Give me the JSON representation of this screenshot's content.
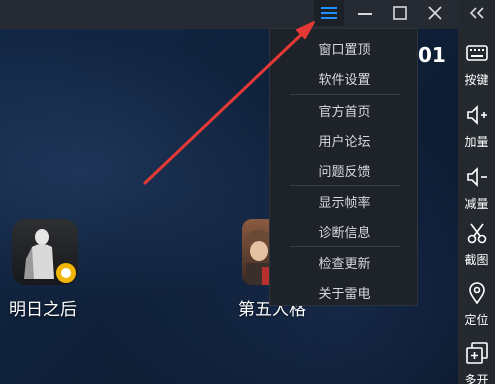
{
  "titlebar": {
    "icons": {
      "menu": "hamburger-menu-icon",
      "minimize": "minimize-icon",
      "maximize": "maximize-icon",
      "close": "close-icon"
    },
    "accent_color": "#1e90ff"
  },
  "desktop": {
    "clock_partial": "01",
    "apps": [
      {
        "label": "明日之后"
      },
      {
        "label": "第五人格"
      }
    ]
  },
  "menu": {
    "items": [
      {
        "label": "窗口置顶"
      },
      {
        "label": "软件设置"
      },
      {
        "label": "官方首页"
      },
      {
        "label": "用户论坛"
      },
      {
        "label": "问题反馈"
      },
      {
        "label": "显示帧率"
      },
      {
        "label": "诊断信息"
      },
      {
        "label": "检查更新"
      },
      {
        "label": "关于雷电"
      }
    ]
  },
  "toolbar": {
    "collapse_icon": "double-chevron-left-icon",
    "buttons": [
      {
        "label": "按键",
        "icon": "keyboard-icon"
      },
      {
        "label": "加量",
        "icon": "volume-up-icon"
      },
      {
        "label": "减量",
        "icon": "volume-down-icon"
      },
      {
        "label": "截图",
        "icon": "scissors-icon"
      },
      {
        "label": "定位",
        "icon": "location-pin-icon"
      },
      {
        "label": "多开",
        "icon": "multi-window-icon"
      }
    ]
  },
  "annotation": {
    "arrow_color": "#e53935"
  }
}
